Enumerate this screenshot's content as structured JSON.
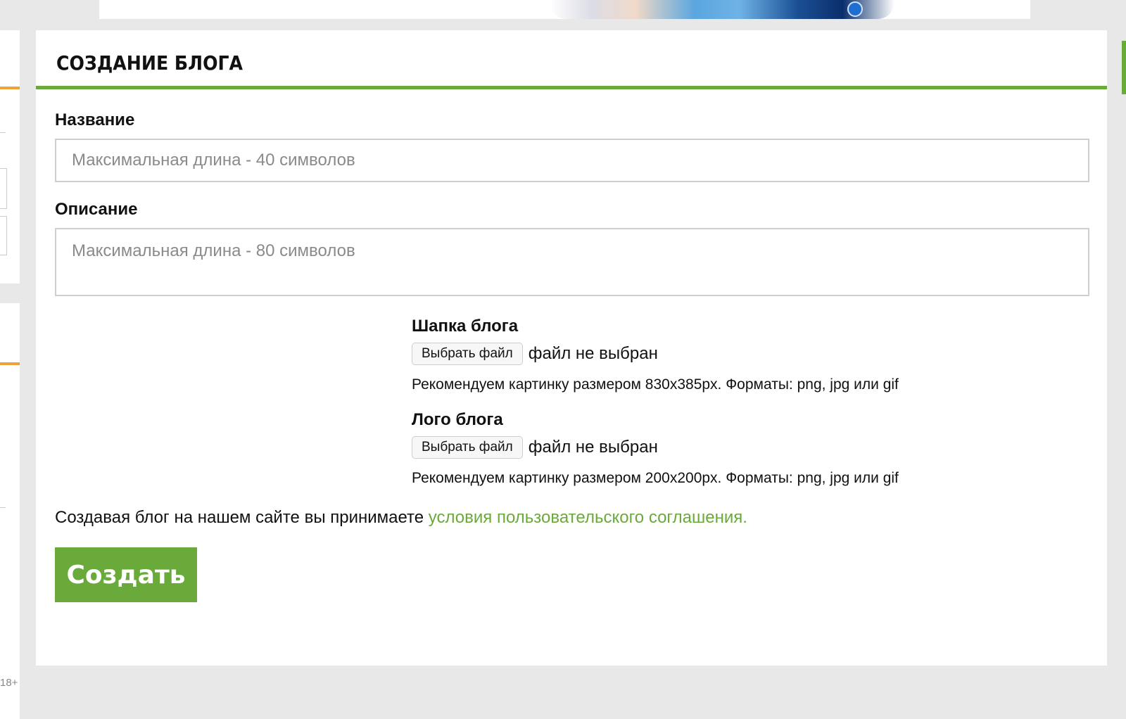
{
  "page": {
    "title": "СОЗДАНИЕ БЛОГА",
    "age_rating": "18+"
  },
  "form": {
    "name": {
      "label": "Название",
      "placeholder": "Максимальная длина - 40 символов"
    },
    "description": {
      "label": "Описание",
      "placeholder": "Максимальная длина - 80 символов"
    },
    "header_upload": {
      "label": "Шапка блога",
      "button_label": "Выбрать файл",
      "status": "файл не выбран",
      "hint": "Рекомендуем картинку размером 830x385px. Форматы: png, jpg или gif"
    },
    "logo_upload": {
      "label": "Лого блога",
      "button_label": "Выбрать файл",
      "status": "файл не выбран",
      "hint": "Рекомендуем картинку размером 200x200px. Форматы: png, jpg или gif"
    },
    "terms": {
      "text": "Создавая блог на нашем сайте вы принимаете ",
      "link_text": "условия пользовательского соглашения."
    },
    "submit_label": "Создать"
  },
  "colors": {
    "accent_green": "#6aaa3a",
    "accent_orange": "#f0a23a",
    "background": "#e8e8e8"
  }
}
